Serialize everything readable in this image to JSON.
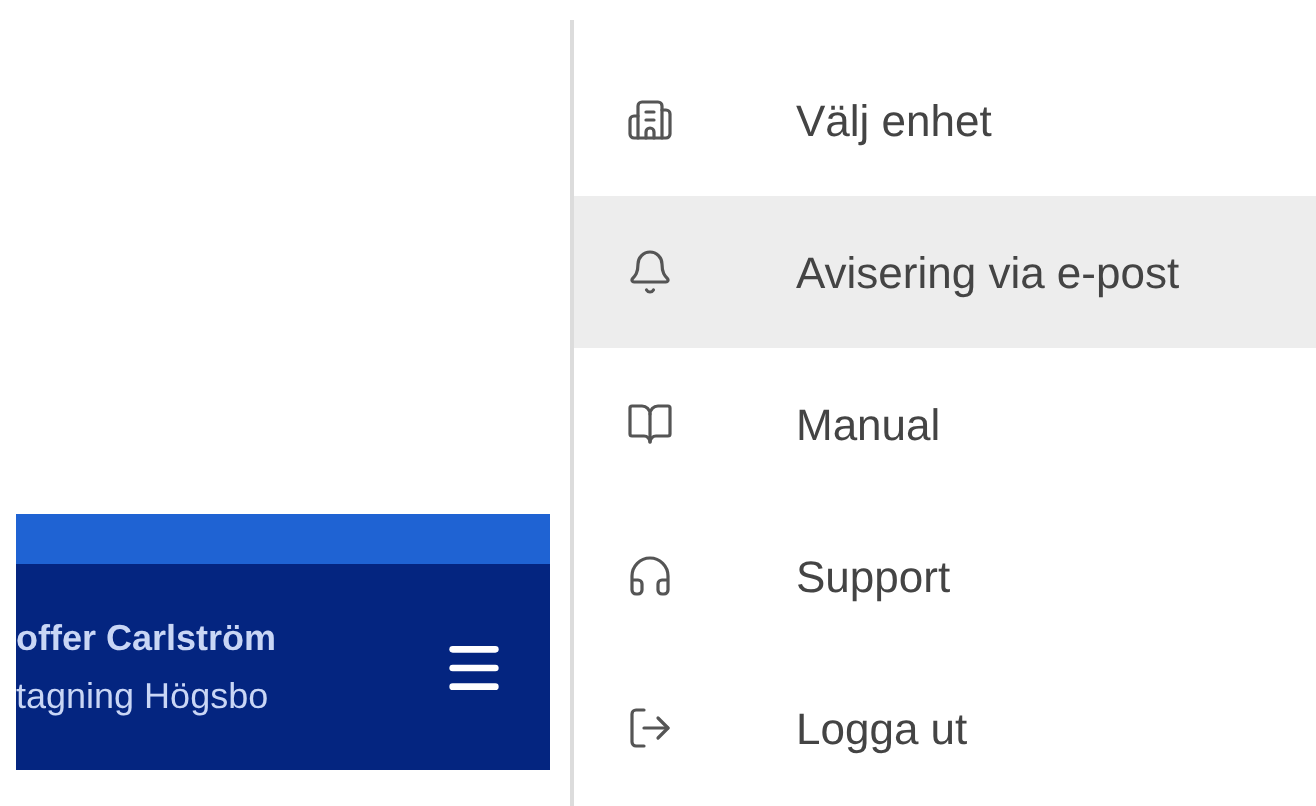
{
  "header": {
    "user_name": "offer Carlström",
    "user_unit": "tagning Högsbo"
  },
  "menu": {
    "items": [
      {
        "label": "Välj enhet",
        "selected": false
      },
      {
        "label": "Avisering via e-post",
        "selected": true
      },
      {
        "label": "Manual",
        "selected": false
      },
      {
        "label": "Support",
        "selected": false
      },
      {
        "label": "Logga ut",
        "selected": false
      }
    ]
  }
}
